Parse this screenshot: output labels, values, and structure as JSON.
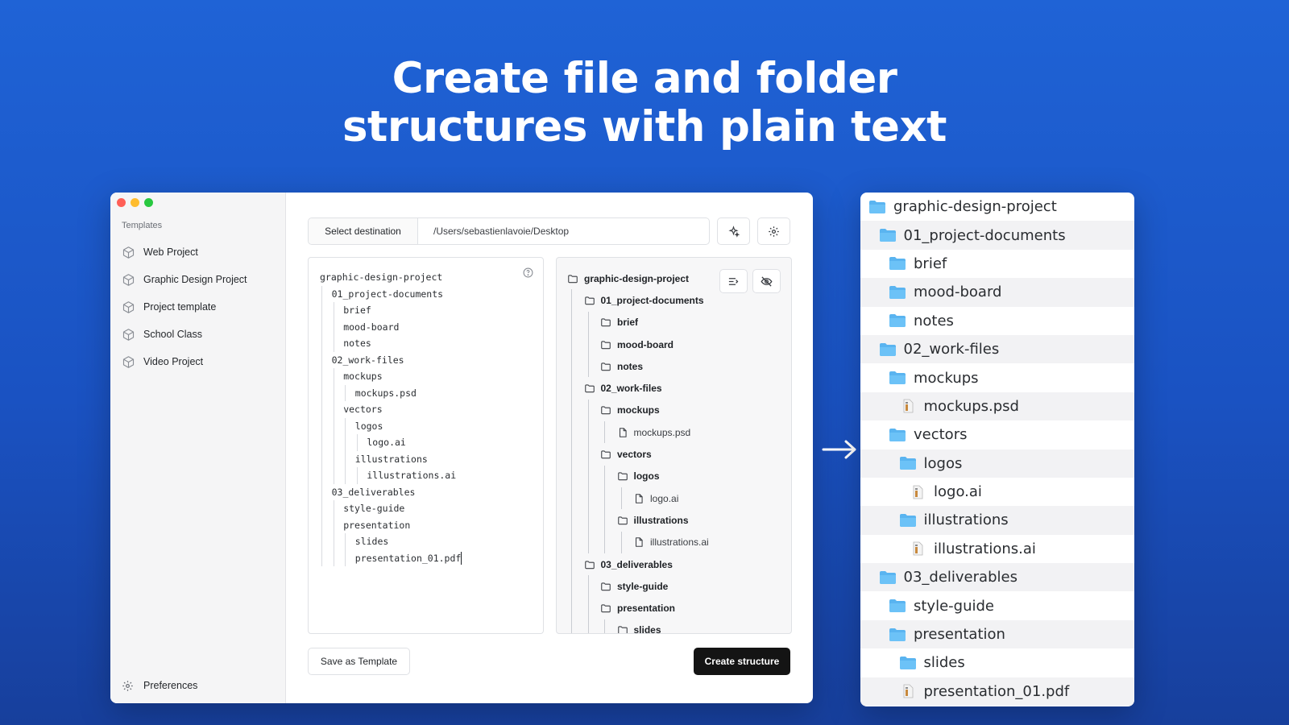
{
  "headline": {
    "line1": "Create file and folder",
    "line2": "structures with plain text"
  },
  "window": {
    "sidebar": {
      "section_label": "Templates",
      "items": [
        {
          "label": "Web Project",
          "icon": "cube-icon"
        },
        {
          "label": "Graphic Design Project",
          "icon": "cube-icon"
        },
        {
          "label": "Project template",
          "icon": "cube-icon"
        },
        {
          "label": "School Class",
          "icon": "cube-icon"
        },
        {
          "label": "Video Project",
          "icon": "cube-icon"
        }
      ],
      "preferences_label": "Preferences"
    },
    "destination": {
      "button_label": "Select destination",
      "path": "/Users/sebastienlavoie/Desktop"
    },
    "editor": {
      "lines": [
        {
          "depth": 0,
          "text": "graphic-design-project"
        },
        {
          "depth": 1,
          "text": "01_project-documents"
        },
        {
          "depth": 2,
          "text": "brief"
        },
        {
          "depth": 2,
          "text": "mood-board"
        },
        {
          "depth": 2,
          "text": "notes"
        },
        {
          "depth": 1,
          "text": "02_work-files"
        },
        {
          "depth": 2,
          "text": "mockups"
        },
        {
          "depth": 3,
          "text": "mockups.psd"
        },
        {
          "depth": 2,
          "text": "vectors"
        },
        {
          "depth": 3,
          "text": "logos"
        },
        {
          "depth": 4,
          "text": "logo.ai"
        },
        {
          "depth": 3,
          "text": "illustrations"
        },
        {
          "depth": 4,
          "text": "illustrations.ai"
        },
        {
          "depth": 1,
          "text": "03_deliverables"
        },
        {
          "depth": 2,
          "text": "style-guide"
        },
        {
          "depth": 2,
          "text": "presentation"
        },
        {
          "depth": 3,
          "text": "slides"
        },
        {
          "depth": 3,
          "text": "presentation_01.pdf"
        }
      ]
    },
    "preview": {
      "rows": [
        {
          "depth": 0,
          "type": "folder",
          "text": "graphic-design-project"
        },
        {
          "depth": 1,
          "type": "folder",
          "text": "01_project-documents"
        },
        {
          "depth": 2,
          "type": "folder",
          "text": "brief"
        },
        {
          "depth": 2,
          "type": "folder",
          "text": "mood-board"
        },
        {
          "depth": 2,
          "type": "folder",
          "text": "notes"
        },
        {
          "depth": 1,
          "type": "folder",
          "text": "02_work-files"
        },
        {
          "depth": 2,
          "type": "folder",
          "text": "mockups"
        },
        {
          "depth": 3,
          "type": "file",
          "text": "mockups.psd"
        },
        {
          "depth": 2,
          "type": "folder",
          "text": "vectors"
        },
        {
          "depth": 3,
          "type": "folder",
          "text": "logos"
        },
        {
          "depth": 4,
          "type": "file",
          "text": "logo.ai"
        },
        {
          "depth": 3,
          "type": "folder",
          "text": "illustrations"
        },
        {
          "depth": 4,
          "type": "file",
          "text": "illustrations.ai"
        },
        {
          "depth": 1,
          "type": "folder",
          "text": "03_deliverables"
        },
        {
          "depth": 2,
          "type": "folder",
          "text": "style-guide"
        },
        {
          "depth": 2,
          "type": "folder",
          "text": "presentation"
        },
        {
          "depth": 3,
          "type": "folder",
          "text": "slides"
        }
      ]
    },
    "footer": {
      "save_template_label": "Save as Template",
      "create_label": "Create structure"
    }
  },
  "finder": {
    "rows": [
      {
        "depth": 0,
        "type": "folder",
        "text": "graphic-design-project"
      },
      {
        "depth": 1,
        "type": "folder",
        "text": "01_project-documents"
      },
      {
        "depth": 2,
        "type": "folder",
        "text": "brief"
      },
      {
        "depth": 2,
        "type": "folder",
        "text": "mood-board"
      },
      {
        "depth": 2,
        "type": "folder",
        "text": "notes"
      },
      {
        "depth": 1,
        "type": "folder",
        "text": "02_work-files"
      },
      {
        "depth": 2,
        "type": "folder",
        "text": "mockups"
      },
      {
        "depth": 3,
        "type": "file",
        "text": "mockups.psd"
      },
      {
        "depth": 2,
        "type": "folder",
        "text": "vectors"
      },
      {
        "depth": 3,
        "type": "folder",
        "text": "logos"
      },
      {
        "depth": 4,
        "type": "file",
        "text": "logo.ai"
      },
      {
        "depth": 3,
        "type": "folder",
        "text": "illustrations"
      },
      {
        "depth": 4,
        "type": "file",
        "text": "illustrations.ai"
      },
      {
        "depth": 1,
        "type": "folder",
        "text": "03_deliverables"
      },
      {
        "depth": 2,
        "type": "folder",
        "text": "style-guide"
      },
      {
        "depth": 2,
        "type": "folder",
        "text": "presentation"
      },
      {
        "depth": 3,
        "type": "folder",
        "text": "slides"
      },
      {
        "depth": 3,
        "type": "file",
        "text": "presentation_01.pdf"
      }
    ]
  },
  "colors": {
    "background_top": "#1f63d6",
    "background_bottom": "#173f9c",
    "finder_folder": "#5ab4f0",
    "create_button": "#141414"
  }
}
